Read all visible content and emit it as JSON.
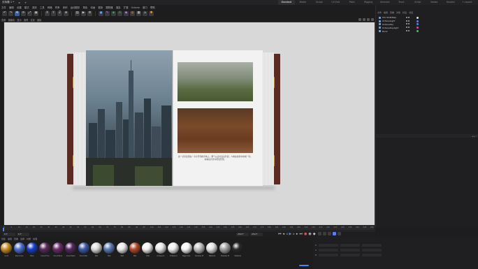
{
  "document": {
    "tab_title": "无标题 1 *",
    "close_icon": "close-icon"
  },
  "layout_tabs": [
    "Standard",
    "Model",
    "Sculpt",
    "UV Edit",
    "Paint",
    "Rigging",
    "Animate",
    "Track",
    "Script",
    "Nodes",
    "Houdini",
    "+ Layout"
  ],
  "menu": [
    "文件",
    "编辑",
    "创建",
    "模式",
    "选择",
    "工具",
    "网格",
    "样条",
    "体积",
    "运动图形",
    "角色",
    "动画",
    "模拟",
    "跟踪器",
    "渲染",
    "扩展",
    "Octane",
    "窗口",
    "帮助"
  ],
  "toolbar": {
    "icons": [
      "undo-icon",
      "redo-icon",
      "move-icon",
      "rotate-icon",
      "scale-icon",
      "select-icon",
      "x-axis-icon",
      "y-axis-icon",
      "z-axis-icon",
      "coord-icon",
      "render-region-icon",
      "render-view-icon",
      "render-settings-icon",
      "cube-icon",
      "pen-icon",
      "subdivision-icon",
      "array-icon",
      "deformer-icon",
      "field-icon",
      "scene-icon",
      "camera-icon",
      "light-icon"
    ]
  },
  "viewport": {
    "menu": [
      "查看",
      "摄像机",
      "显示",
      "选项",
      "过滤",
      "面板"
    ],
    "book": {
      "caption": "这一全景出现在一大片开阔的草地上，雾气从远方袅袅升起，人物在前景中排成一列，树林在背景中若隐若现。"
    }
  },
  "object_manager": {
    "menu": [
      "文件",
      "编辑",
      "查看",
      "对象",
      "标签",
      "书签"
    ],
    "objects": [
      {
        "name": "Hdr RGB/Map",
        "tag_color": "#e0e0e0"
      },
      {
        "name": "OctaneLight",
        "tag_color": "#4a84ff"
      },
      {
        "name": "OctaneSky",
        "tag_color": "#4a84ff"
      },
      {
        "name": "OctaneDaylight",
        "tag_color": "#e84a8a"
      },
      {
        "name": "Book",
        "tag_color": "#44c06a"
      }
    ]
  },
  "timeline": {
    "ticks": [
      "0",
      "5",
      "10",
      "15",
      "20",
      "25",
      "30",
      "35",
      "40",
      "45",
      "50",
      "55",
      "60",
      "65",
      "70",
      "75",
      "80",
      "85",
      "90",
      "95",
      "100",
      "105",
      "110",
      "115",
      "120",
      "125",
      "130",
      "135",
      "140",
      "145",
      "150",
      "155",
      "160",
      "165",
      "170",
      "175",
      "180",
      "185",
      "190",
      "195",
      "200",
      "205",
      "210",
      "215",
      "220",
      "225",
      "230",
      "235",
      "240",
      "245",
      "250"
    ],
    "current_frame": "0 F",
    "start_frame": "0 F",
    "end_frame": "250 F",
    "max_frame": "250 F"
  },
  "transport": {
    "icons": [
      "first-frame-icon",
      "prev-key-icon",
      "prev-frame-icon",
      "play-icon",
      "next-frame-icon",
      "next-key-icon",
      "last-frame-icon",
      "record-icon",
      "autokey-icon",
      "keyframe-icon"
    ]
  },
  "material_manager": {
    "menu": [
      "创建",
      "编辑",
      "查看",
      "选择",
      "材质",
      "纹理"
    ],
    "materials": [
      {
        "name": "Gold",
        "color": "#c8902a"
      },
      {
        "name": "Pearl blue",
        "color": "#4a6fd0"
      },
      {
        "name": "Blue",
        "color": "#1a3ec8"
      },
      {
        "name": "Cloud Fore",
        "color": "#5b2a5c"
      },
      {
        "name": "Cloud Back",
        "color": "#6a2c6a"
      },
      {
        "name": "Cloud Back",
        "color": "#552860"
      },
      {
        "name": "Cloud Bac",
        "color": "#3b5aa8"
      },
      {
        "name": "Mat",
        "color": "#d9d9d9"
      },
      {
        "name": "Mat",
        "color": "#5a7cb0"
      },
      {
        "name": "Mat",
        "color": "#e8e8e8"
      },
      {
        "name": "Mat",
        "color": "#b04a2a"
      },
      {
        "name": "Mat",
        "color": "#f0f0f0"
      },
      {
        "name": "OcSpecul",
        "color": "#e6e6e6"
      },
      {
        "name": "OcSpecul",
        "color": "#eeeeee"
      },
      {
        "name": "Page Colo",
        "color": "#f5f5f5"
      },
      {
        "name": "Shadow M",
        "color": "#bdbdbd"
      },
      {
        "name": "Material",
        "color": "#e0e0e0"
      },
      {
        "name": "Shadow M",
        "color": "#a0a0a0"
      },
      {
        "name": "Material",
        "color": "#2a2a2a"
      }
    ]
  },
  "coordinates": {
    "rows": [
      "P",
      "S",
      "R"
    ]
  }
}
